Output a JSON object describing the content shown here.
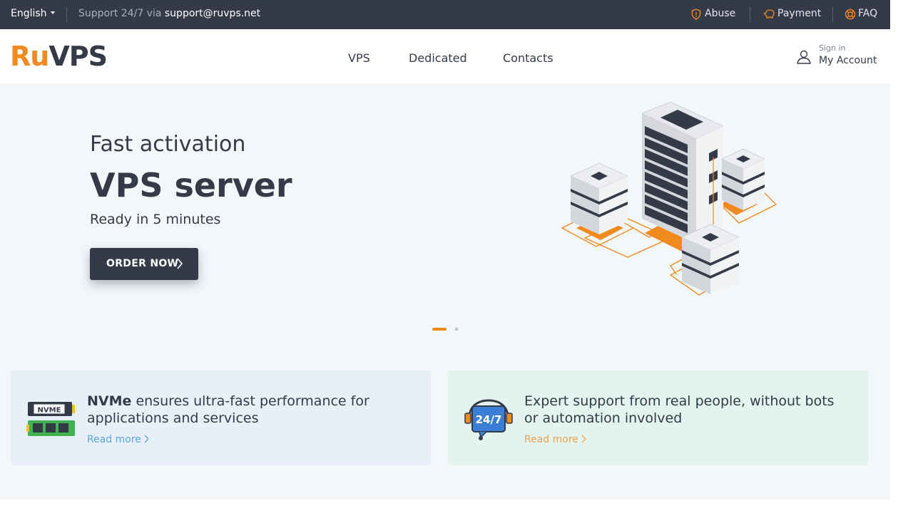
{
  "topbar": {
    "language": "English",
    "support_prefix": "Support 24/7 via",
    "support_email": "support@ruvps.net",
    "links": [
      {
        "label": "Abuse",
        "icon": "shield-icon"
      },
      {
        "label": "Payment",
        "icon": "piggy-bank-icon"
      },
      {
        "label": "FAQ",
        "icon": "lifebuoy-icon"
      }
    ]
  },
  "header": {
    "logo_ru": "Ru",
    "logo_vps": "VPS",
    "nav": [
      "VPS",
      "Dedicated",
      "Contacts"
    ],
    "account_small": "Sign in",
    "account_big": "My Account"
  },
  "hero": {
    "line1": "Fast activation",
    "line2": "VPS server",
    "line3": "Ready in 5 minutes",
    "cta": "ORDER NOW",
    "slides_total": 2,
    "slide_active": 1
  },
  "features": [
    {
      "bold": "NVMe",
      "text": " ensures ultra-fast performance for applications and services",
      "link": "Read more",
      "icon": "nvme-icon"
    },
    {
      "bold": "",
      "text": "Expert support from real people, without bots or automation involved",
      "link": "Read more",
      "icon": "support-24-7-icon"
    }
  ],
  "colors": {
    "accent": "#f08a1e",
    "dark": "#343a48",
    "link_blue": "#5aa7e0",
    "link_orange": "#f0a253"
  }
}
